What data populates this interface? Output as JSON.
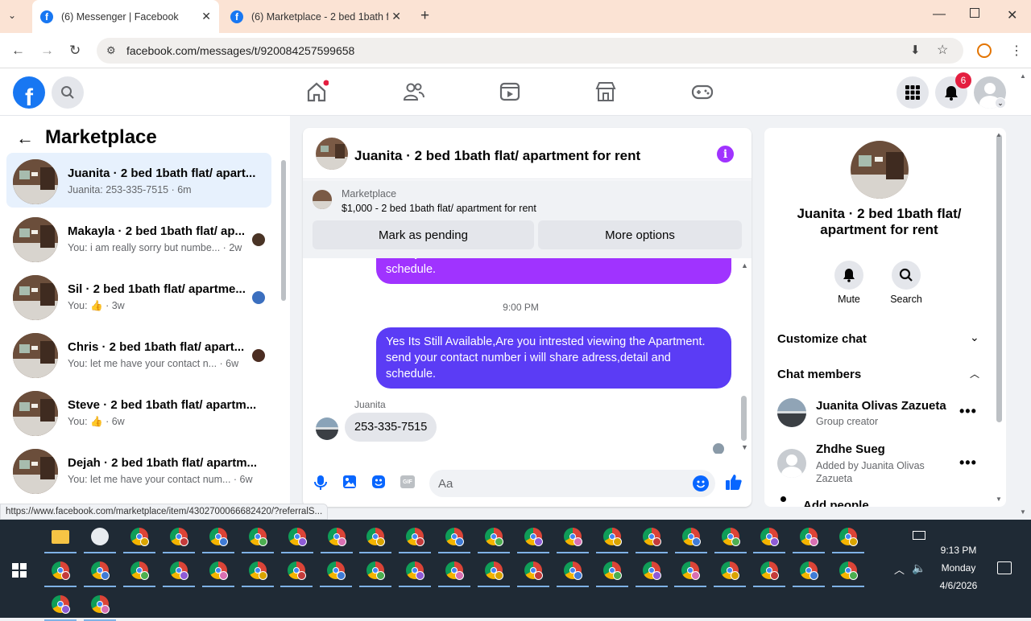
{
  "browser": {
    "tabs": [
      {
        "title": "(6) Messenger | Facebook",
        "active": true
      },
      {
        "title": "(6) Marketplace - 2 bed 1bath f",
        "active": false
      }
    ],
    "url": "facebook.com/messages/t/920084257599658"
  },
  "fb_header": {
    "notifications_count": "6"
  },
  "left_panel": {
    "title": "Marketplace",
    "conversations": [
      {
        "title": "Juanita · 2 bed 1bath flat/ apart...",
        "preview": "Juanita: 253-335-7515 · 6m",
        "selected": true
      },
      {
        "title": "Makayla · 2 bed 1bath flat/ ap...",
        "preview": "You: i am really sorry but numbe... · 2w"
      },
      {
        "title": "Sil · 2 bed 1bath flat/ apartme...",
        "preview": "You: 👍 · 3w"
      },
      {
        "title": "Chris · 2 bed 1bath flat/ apart...",
        "preview": "You: let me have your contact n... · 6w"
      },
      {
        "title": "Steve · 2 bed 1bath flat/ apartm...",
        "preview": "You: 👍 · 6w"
      },
      {
        "title": "Dejah · 2 bed 1bath flat/ apartm...",
        "preview": "You: let me have your contact num... · 6w"
      }
    ]
  },
  "chat": {
    "title": "Juanita · 2 bed 1bath flat/ apartment for rent",
    "listing_label": "Marketplace",
    "listing_text": "$1,000 - 2 bed 1bath flat/ apartment for rent",
    "mark_pending": "Mark as pending",
    "more_options": "More options",
    "partial_message": "send your contact number i will share adress,detail and schedule.",
    "timestamp": "9:00 PM",
    "sent_message": "Yes Its Still Available,Are you intrested viewing the Apartment. send your contact number i will share adress,detail and schedule.",
    "sender_name": "Juanita",
    "received_message": "253-335-7515",
    "input_placeholder": "Aa"
  },
  "right_panel": {
    "name": "Juanita · 2 bed 1bath flat/ apartment for rent",
    "mute": "Mute",
    "search": "Search",
    "customize": "Customize chat",
    "members_heading": "Chat members",
    "members": [
      {
        "name": "Juanita Olivas Zazueta",
        "role": "Group creator"
      },
      {
        "name": "Zhdhe Sueg",
        "role": "Added by Juanita Olivas Zazueta"
      }
    ],
    "add_people": "Add people"
  },
  "status_url": "https://www.facebook.com/marketplace/item/4302700066682420/?referralS...",
  "taskbar": {
    "time": "9:13 PM",
    "day": "Monday",
    "date": "4/6/2026"
  },
  "colors": {
    "fb_blue": "#1877f2",
    "purple": "#a033ff",
    "indigo": "#5b3cf5"
  }
}
